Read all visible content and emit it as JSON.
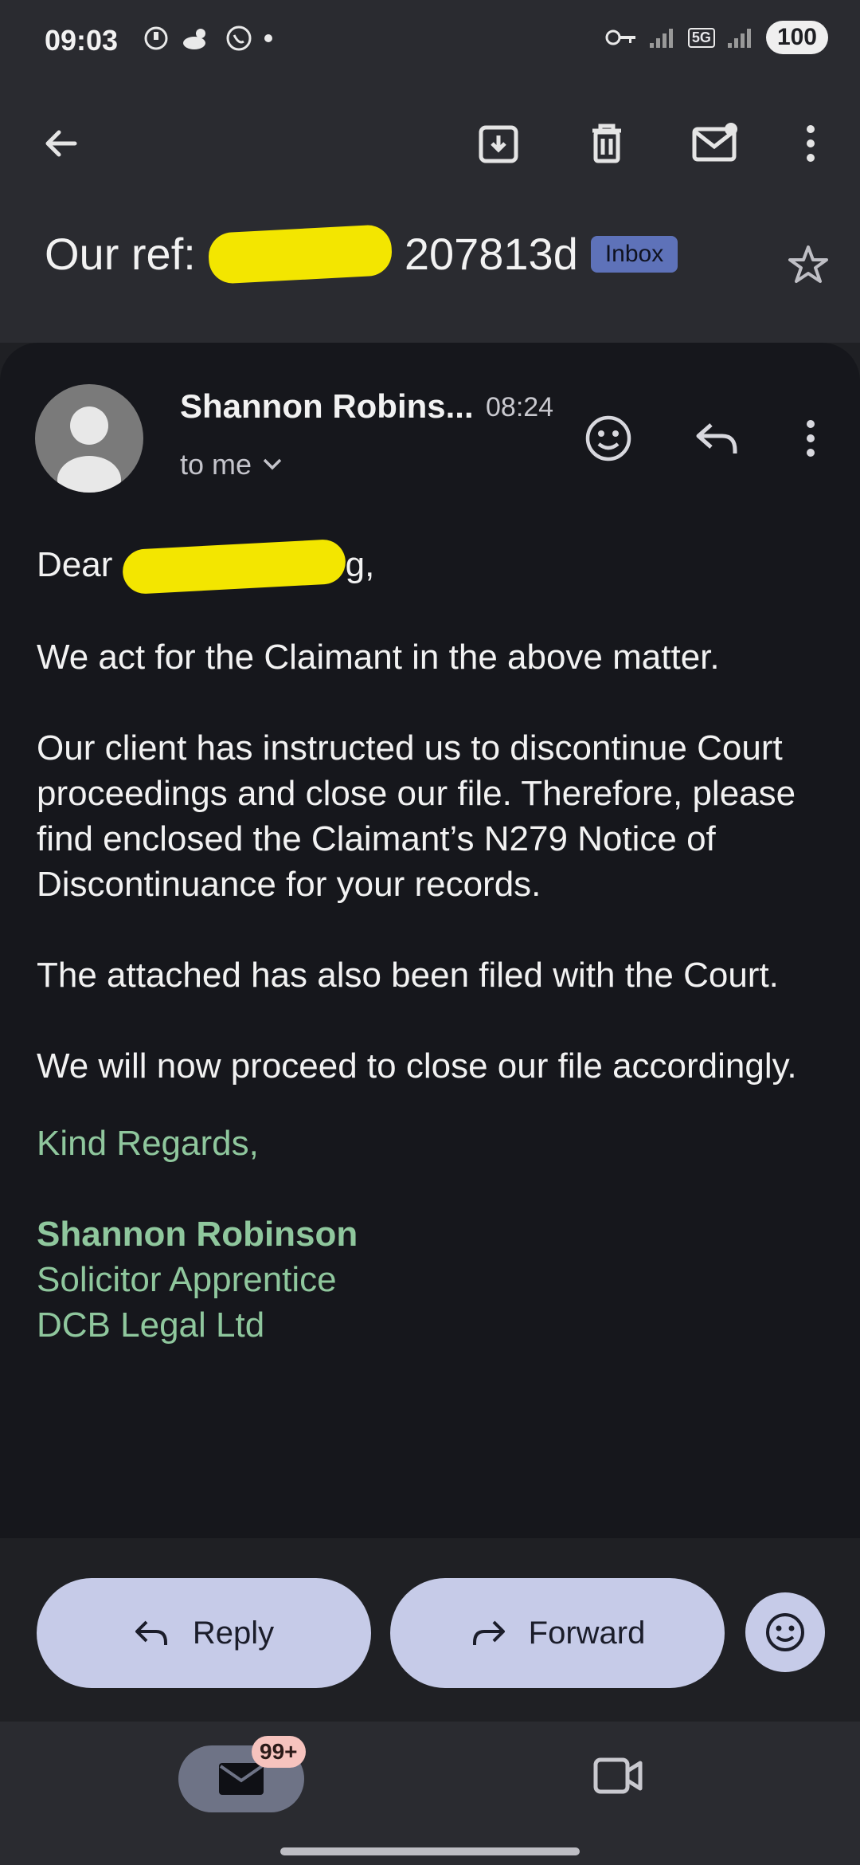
{
  "status_bar": {
    "time": "09:03",
    "icons_left": [
      "vpn-icon",
      "weather-icon",
      "whatsapp-icon",
      "dot"
    ],
    "network": "5G",
    "battery": "100"
  },
  "toolbar": {
    "icons": [
      "back-arrow-icon",
      "archive-icon",
      "trash-icon",
      "mark-unread-icon",
      "more-vertical-icon"
    ]
  },
  "subject": {
    "text_prefix": "Our ref:",
    "text_suffix": "207813d",
    "label": "Inbox"
  },
  "email": {
    "sender": "Shannon Robins...",
    "time": "08:24",
    "recipient": "to me",
    "greeting_prefix": "Dear",
    "greeting_suffix": "g,",
    "paragraphs": [
      "We act for the Claimant in the above matter.",
      "Our client has instructed us to discontinue Court proceedings and close our file. Therefore, please find enclosed the Claimant’s N279 Notice of Discontinuance for your records.",
      "The attached has also been filed with the Court.",
      "We will now proceed to close our file accordingly."
    ],
    "signature": {
      "closing": "Kind Regards,",
      "name": "Shannon Robinson",
      "title": "Solicitor Apprentice",
      "company": "DCB Legal Ltd"
    }
  },
  "actions": {
    "reply_label": "Reply",
    "forward_label": "Forward"
  },
  "bottom_nav": {
    "mail_badge": "99+"
  },
  "colors": {
    "accent": "#c6cbe8",
    "signature_green": "#8fc79d",
    "badge_blue": "#5e72b9",
    "redaction_yellow": "#f3e600"
  }
}
